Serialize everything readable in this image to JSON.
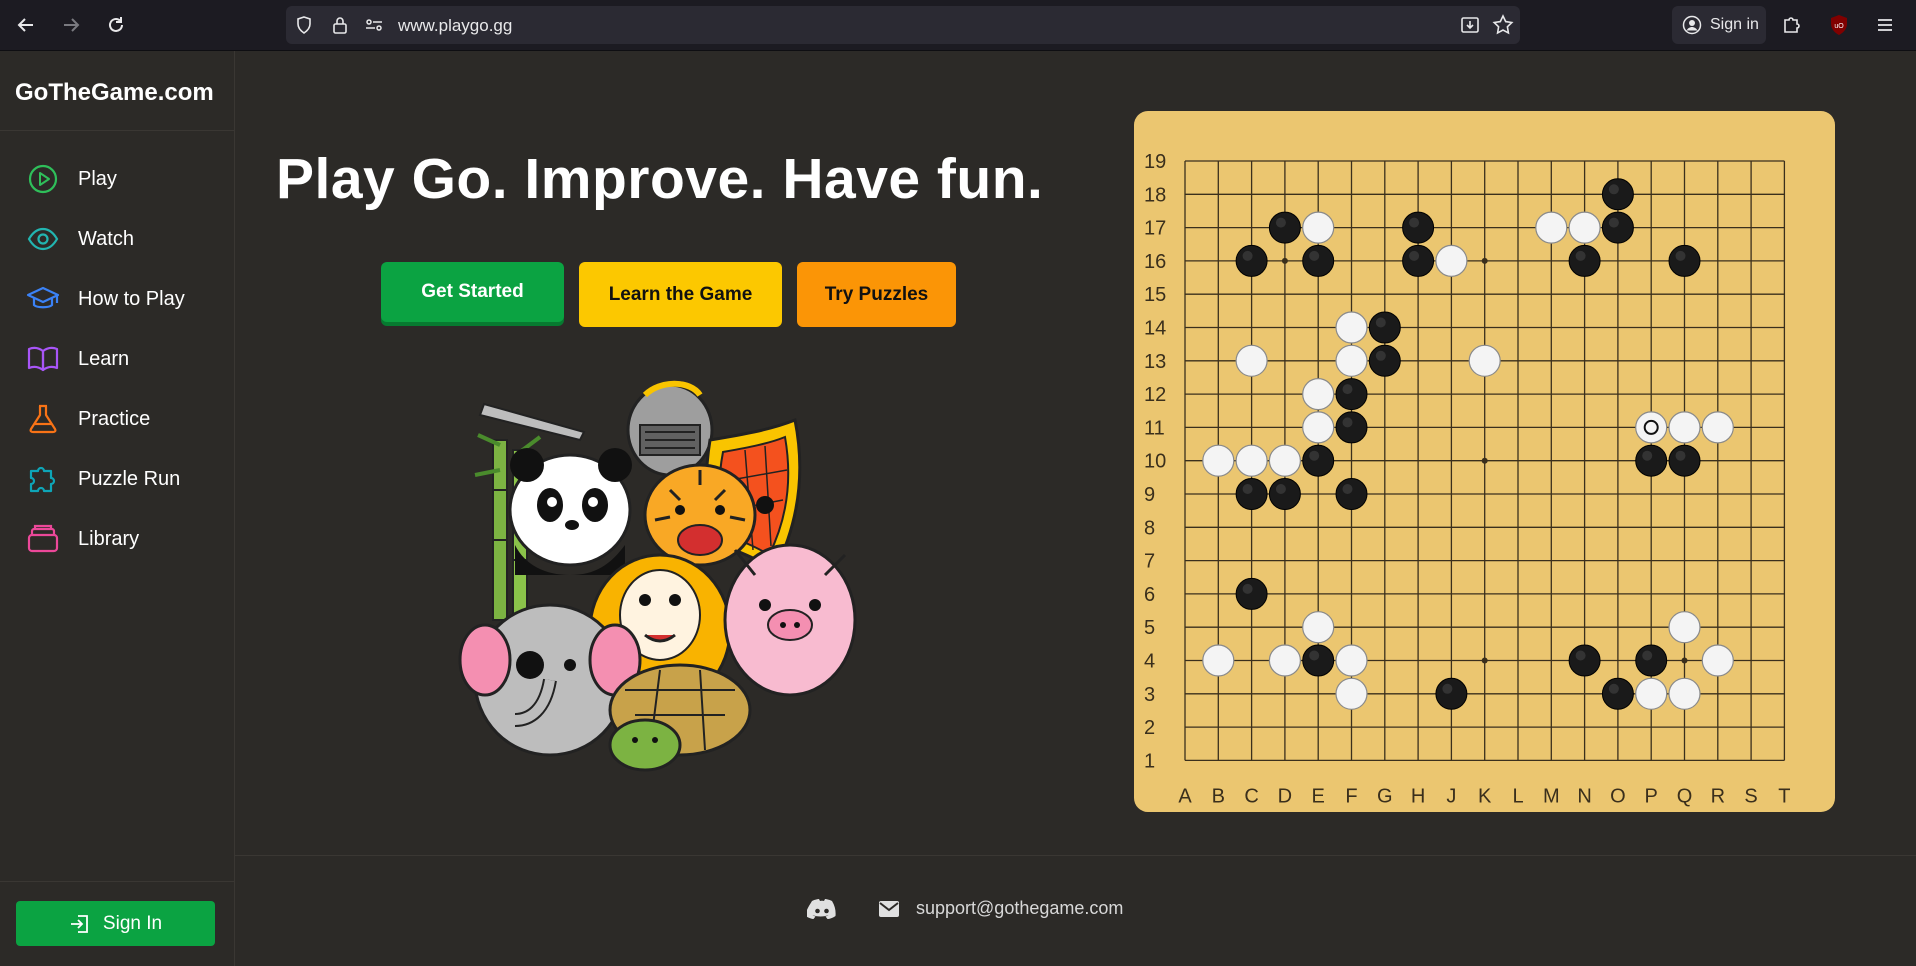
{
  "browser": {
    "url": "www.playgo.gg",
    "sign_in_label": "Sign in"
  },
  "sidebar": {
    "brand": "GoTheGame.com",
    "items": [
      {
        "label": "Play",
        "icon": "play-circle-icon",
        "color": "#2fbf5a"
      },
      {
        "label": "Watch",
        "icon": "eye-icon",
        "color": "#22b5b0"
      },
      {
        "label": "How to Play",
        "icon": "graduation-cap-icon",
        "color": "#3b82f6"
      },
      {
        "label": "Learn",
        "icon": "book-icon",
        "color": "#a855f7"
      },
      {
        "label": "Practice",
        "icon": "flask-icon",
        "color": "#f97316"
      },
      {
        "label": "Puzzle Run",
        "icon": "puzzle-icon",
        "color": "#0ea5b7"
      },
      {
        "label": "Library",
        "icon": "stack-icon",
        "color": "#ec4899"
      }
    ],
    "sign_in_label": "Sign In"
  },
  "hero": {
    "headline": "Play Go. Improve. Have fun.",
    "buttons": {
      "get_started": "Get Started",
      "learn_game": "Learn the Game",
      "try_puzzles": "Try Puzzles"
    }
  },
  "board": {
    "size": 19,
    "columns": [
      "A",
      "B",
      "C",
      "D",
      "E",
      "F",
      "G",
      "H",
      "J",
      "K",
      "L",
      "M",
      "N",
      "O",
      "P",
      "Q",
      "R",
      "S",
      "T"
    ],
    "rows": [
      "19",
      "18",
      "17",
      "16",
      "15",
      "14",
      "13",
      "12",
      "11",
      "10",
      "9",
      "8",
      "7",
      "6",
      "5",
      "4",
      "3",
      "2",
      "1"
    ],
    "black_stones": [
      "O18",
      "D17",
      "H17",
      "O17",
      "C16",
      "E16",
      "H16",
      "N16",
      "Q16",
      "G14",
      "G13",
      "F12",
      "F11",
      "E10",
      "P10",
      "Q10",
      "C9",
      "D9",
      "F9",
      "C6",
      "E4",
      "N4",
      "P4",
      "J3",
      "O3"
    ],
    "white_stones": [
      "E17",
      "M17",
      "N17",
      "J16",
      "F14",
      "C13",
      "F13",
      "K13",
      "E12",
      "E11",
      "Q11",
      "R11",
      "B10",
      "C10",
      "D10",
      "E5",
      "Q5",
      "B4",
      "D4",
      "F4",
      "R4",
      "F3",
      "P3",
      "Q3"
    ],
    "last_move": "P11",
    "colors": {
      "wood": "#ebc670",
      "line": "#3a2f1c"
    }
  },
  "footer": {
    "discord_icon": "discord-icon",
    "email_icon": "mail-icon",
    "email": "support@gothegame.com"
  },
  "colors": {
    "bg": "#2c2a27",
    "primary": "#0ba342",
    "yellow": "#fcc800",
    "orange": "#fb9506"
  }
}
